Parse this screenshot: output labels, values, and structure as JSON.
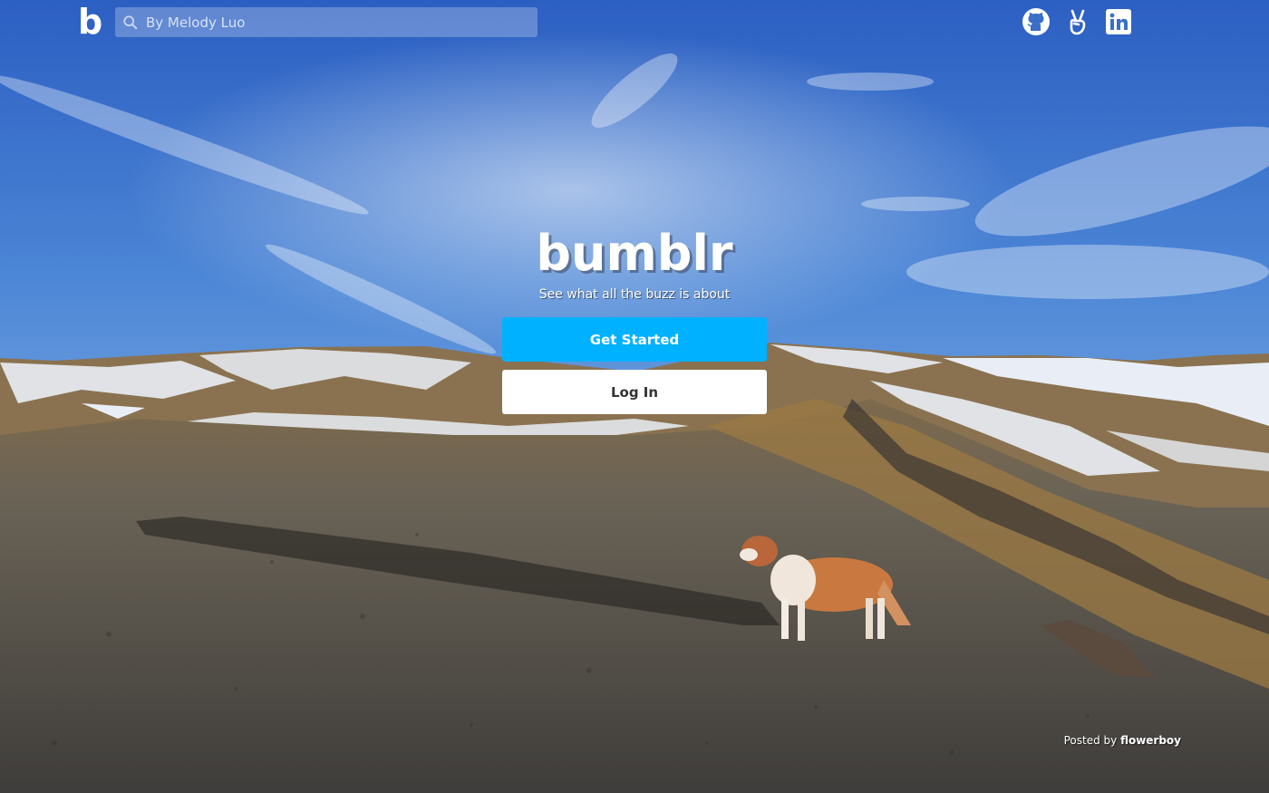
{
  "header": {
    "logo": "b",
    "search": {
      "placeholder": "By Melody Luo",
      "value": ""
    },
    "social": [
      {
        "icon": "github-icon"
      },
      {
        "icon": "angellist-icon"
      },
      {
        "icon": "linkedin-icon"
      }
    ]
  },
  "hero": {
    "title": "bumblr",
    "subtitle": "See what all the buzz is about",
    "primary_button": "Get Started",
    "secondary_button": "Log In"
  },
  "credit": {
    "prefix": "Posted by",
    "author": "flowerboy"
  },
  "colors": {
    "accent": "#00b1ff",
    "sky_top": "#2f62c4",
    "ground": "#55514c"
  }
}
